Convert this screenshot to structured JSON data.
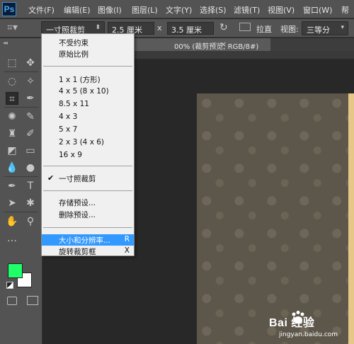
{
  "app": {
    "logo": "Ps"
  },
  "menubar": {
    "items": [
      "文件(F)",
      "编辑(E)",
      "图像(I)",
      "图层(L)",
      "文字(Y)",
      "选择(S)",
      "滤镜(T)",
      "视图(V)",
      "窗口(W)",
      "帮"
    ]
  },
  "options": {
    "preset": "一寸照裁剪",
    "width": "2.5 厘米",
    "times": "x",
    "height": "3.5 厘米",
    "straighten_label": "拉直",
    "view_label": "视图:",
    "view_value": "三等分"
  },
  "document": {
    "tab_title": "00% (裁剪预览, RGB/8#)",
    "tab_close": "×"
  },
  "toolbar": {
    "foreground_color": "#1fff6a",
    "background_color": "#ffffff"
  },
  "dropdown": {
    "groups": [
      [
        "不受约束",
        "原始比例"
      ],
      [
        "1 x 1 (方形)",
        "4 x 5 (8 x 10)",
        "8.5 x 11",
        "4 x 3",
        "5 x 7",
        "2 x 3 (4 x 6)",
        "16 x 9"
      ],
      [
        "一寸照裁剪"
      ],
      [
        "存储预设...",
        "删除预设..."
      ],
      [
        "大小和分辨率...",
        "旋转裁剪框"
      ]
    ],
    "checked": "一寸照裁剪",
    "highlighted": "大小和分辨率...",
    "shortcut_resize": "R",
    "shortcut_rotate": "X"
  },
  "watermark": {
    "brand": "Bai 经验",
    "url": "jingyan.baidu.com"
  }
}
